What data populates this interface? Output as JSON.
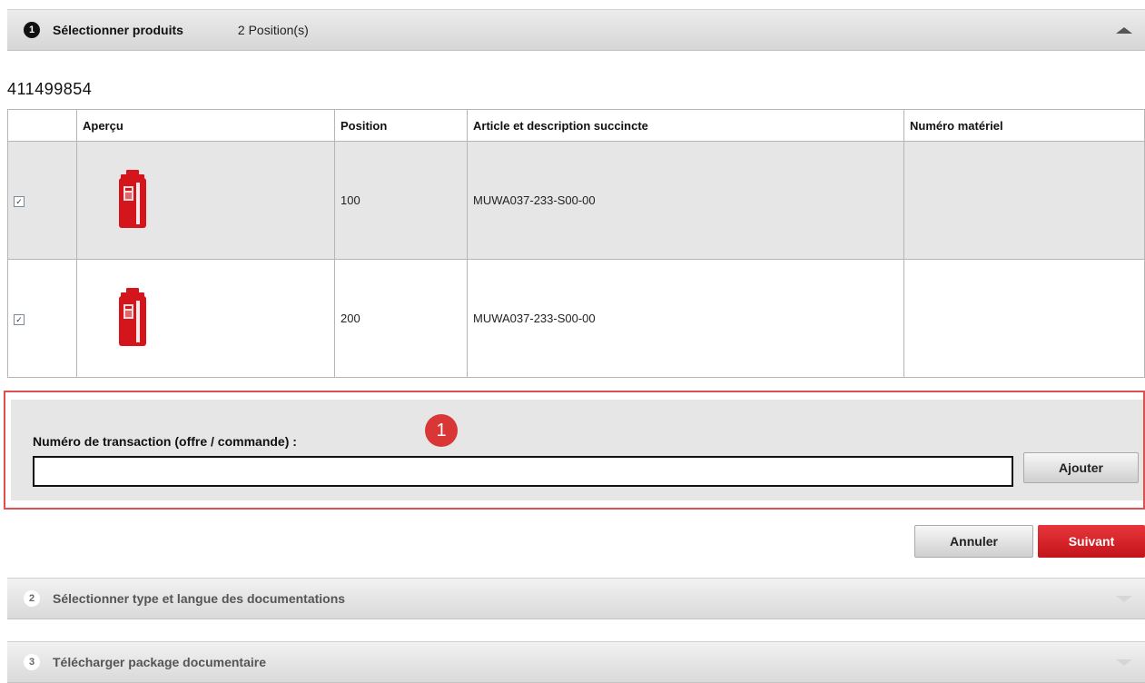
{
  "step1": {
    "number": "1",
    "title": "Sélectionner produits",
    "count": "2 Position(s)"
  },
  "order_number": "411499854",
  "table": {
    "headers": [
      "",
      "Aperçu",
      "Position",
      "Article et description succincte",
      "Numéro matériel"
    ],
    "rows": [
      {
        "checked": true,
        "position": "100",
        "article": "MUWA037-233-S00-00",
        "material": ""
      },
      {
        "checked": true,
        "position": "200",
        "article": "MUWA037-233-S00-00",
        "material": ""
      }
    ]
  },
  "transaction": {
    "label": "Numéro de transaction (offre / commande) :",
    "badge": "1",
    "value": "",
    "placeholder": "",
    "add_label": "Ajouter"
  },
  "actions": {
    "cancel_label": "Annuler",
    "next_label": "Suivant"
  },
  "step2": {
    "number": "2",
    "title": "Sélectionner type et langue des documentations"
  },
  "step3": {
    "number": "3",
    "title": "Télécharger package documentaire"
  },
  "icons": {
    "checkbox_mark": "✓",
    "product_icon": "red-device-icon",
    "expand": "caret-up-icon",
    "collapse": "caret-down-icon"
  },
  "colors": {
    "accent": "#d4151c",
    "highlight_border": "#e05050",
    "badge": "#d93636"
  }
}
